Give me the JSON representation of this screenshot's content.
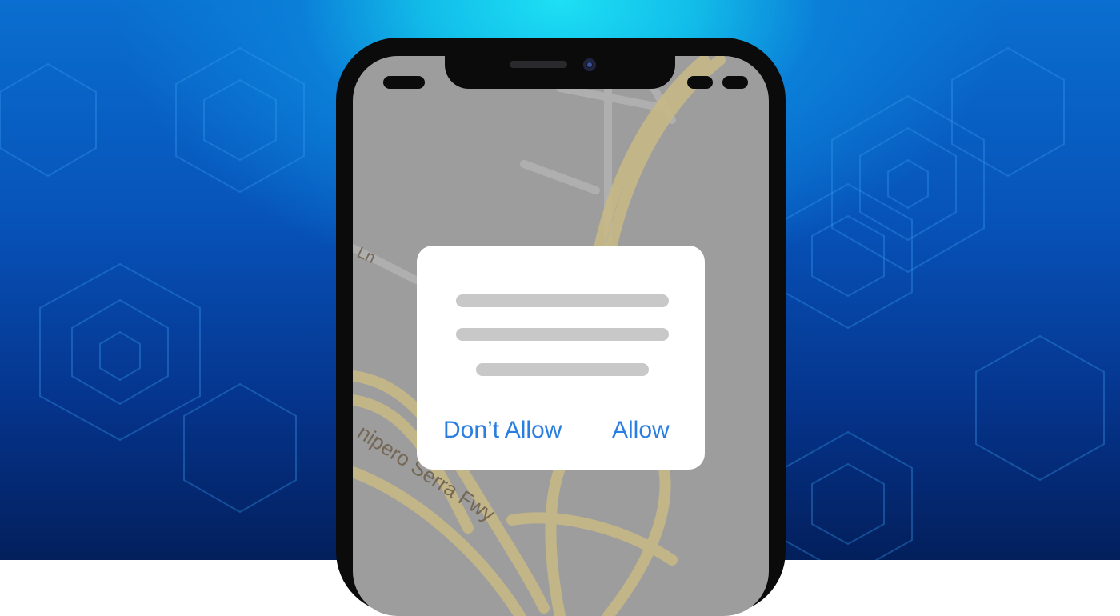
{
  "dialog": {
    "deny_label": "Don’t Allow",
    "allow_label": "Allow"
  },
  "map": {
    "road_label_1": "Ln",
    "road_label_2": "nipero Serra Fwy"
  },
  "colors": {
    "accent": "#2a7de1",
    "placeholder_text": "#c8c8c8",
    "map_background": "#a9a9a9",
    "highway": "#d8c78f"
  },
  "icons": [
    "phone-frame",
    "front-camera",
    "speaker-grille"
  ]
}
